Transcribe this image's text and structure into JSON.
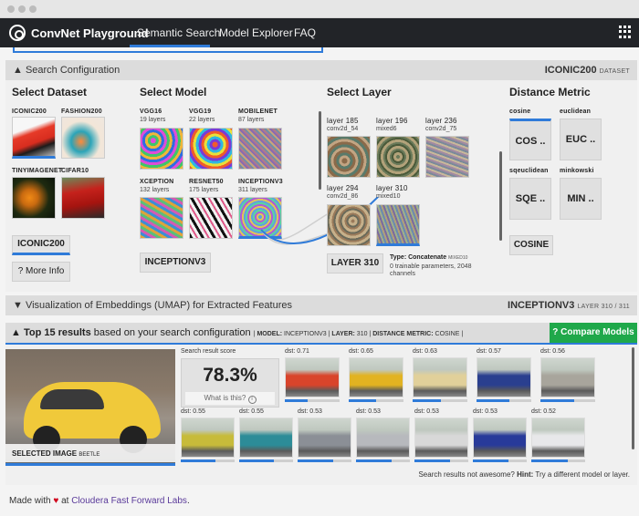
{
  "nav": {
    "brand": "ConvNet Playground",
    "links": [
      "Semantic Search",
      "Model Explorer",
      "FAQ"
    ]
  },
  "search_config": {
    "toggle": "▲ Search Configuration",
    "dataset_badge": "ICONIC200",
    "dataset_badge_sub": "DATASET"
  },
  "dataset": {
    "title": "Select Dataset",
    "items": [
      "ICONIC200",
      "FASHION200",
      "TINYIMAGENET",
      "CIFAR10"
    ],
    "selected_button": "ICONIC200",
    "more_info": "? More Info"
  },
  "model": {
    "title": "Select Model",
    "items": [
      {
        "name": "VGG16",
        "layers": "19 layers"
      },
      {
        "name": "VGG19",
        "layers": "22 layers"
      },
      {
        "name": "MOBILENET",
        "layers": "87 layers"
      },
      {
        "name": "XCEPTION",
        "layers": "132 layers"
      },
      {
        "name": "RESNET50",
        "layers": "175 layers"
      },
      {
        "name": "INCEPTIONV3",
        "layers": "311 layers"
      }
    ],
    "selected_button": "INCEPTIONV3"
  },
  "layer": {
    "title": "Select Layer",
    "items": [
      {
        "name": "layer 185",
        "sub": "conv2d_54"
      },
      {
        "name": "layer 196",
        "sub": "mixed6"
      },
      {
        "name": "layer 236",
        "sub": "conv2d_75"
      },
      {
        "name": "layer 294",
        "sub": "conv2d_86"
      },
      {
        "name": "layer 310",
        "sub": "mixed10"
      }
    ],
    "selected_button": "LAYER 310",
    "type_label": "Type: Concatenate",
    "type_tag": "MIXED10",
    "params": "0 trainable parameters, 2048 channels"
  },
  "metric": {
    "title": "Distance Metric",
    "items": [
      {
        "name": "cosine",
        "abbr": "COS .."
      },
      {
        "name": "euclidean",
        "abbr": "EUC .."
      },
      {
        "name": "sqeuclidean",
        "abbr": "SQE .."
      },
      {
        "name": "minkowski",
        "abbr": "MIN .."
      }
    ],
    "selected_button": "COSINE"
  },
  "umap": {
    "toggle": "▼ Visualization of Embeddings (UMAP) for Extracted Features",
    "model": "INCEPTIONV3",
    "layer_info": "LAYER 310 / 311"
  },
  "results": {
    "title_bold": "▲ Top 15 results",
    "title_rest": "based on your search configuration",
    "config_model_label": "MODEL:",
    "config_model": "INCEPTIONV3",
    "config_layer_label": "LAYER:",
    "config_layer": "310",
    "config_metric_label": "DISTANCE METRIC:",
    "config_metric": "COSINE",
    "compare_button": "? Compare Models",
    "selected_label": "SELECTED IMAGE",
    "selected_tag": "BEETLE",
    "score_label": "Search result score",
    "score_value": "78.3%",
    "what_is_this": "What is this?",
    "row1": [
      {
        "dst": "dst: 0.71",
        "bar": 0.42,
        "color": "#d9442b"
      },
      {
        "dst": "dst: 0.65",
        "bar": 0.5,
        "color": "#e2b321"
      },
      {
        "dst": "dst: 0.63",
        "bar": 0.52,
        "color": "#e1d09a"
      },
      {
        "dst": "dst: 0.57",
        "bar": 0.6,
        "color": "#2a3f8f"
      },
      {
        "dst": "dst: 0.56",
        "bar": 0.62,
        "color": "#a8a59c"
      }
    ],
    "row2": [
      {
        "dst": "dst: 0.55",
        "bar": 0.64,
        "color": "#c7bb3a"
      },
      {
        "dst": "dst: 0.55",
        "bar": 0.64,
        "color": "#2c8c98"
      },
      {
        "dst": "dst: 0.53",
        "bar": 0.66,
        "color": "#8b8f96"
      },
      {
        "dst": "dst: 0.53",
        "bar": 0.66,
        "color": "#b7b9bd"
      },
      {
        "dst": "dst: 0.53",
        "bar": 0.66,
        "color": "#d8d8d8"
      },
      {
        "dst": "dst: 0.53",
        "bar": 0.66,
        "color": "#283a9a"
      },
      {
        "dst": "dst: 0.52",
        "bar": 0.68,
        "color": "#e8e8ea"
      }
    ],
    "hint_prefix": "Search results not awesome?",
    "hint_bold": "Hint:",
    "hint_text": "Try a different model or layer."
  },
  "footer": {
    "made_with": "Made with",
    "heart": "♥",
    "at": "at",
    "link": "Cloudera Fast Forward Labs",
    "period": "."
  },
  "colors": {
    "accent": "#2f7bd9",
    "navbar": "#222428",
    "compare_green": "#1fa84a"
  }
}
